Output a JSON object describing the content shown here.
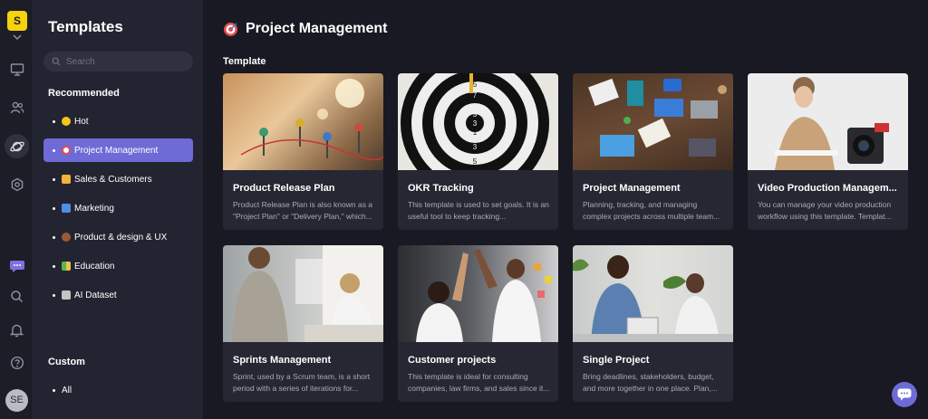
{
  "rail": {
    "logo_letter": "S",
    "user_initials": "SE"
  },
  "sidebar": {
    "title": "Templates",
    "search_placeholder": "Search",
    "recommended_label": "Recommended",
    "items": [
      {
        "label": "Hot",
        "icon": "sun-icon",
        "color": "#f5c518"
      },
      {
        "label": "Project Management",
        "icon": "target-icon",
        "color": "#e54d4d",
        "active": true
      },
      {
        "label": "Sales & Customers",
        "icon": "handshake-icon",
        "color": "#f2b33a"
      },
      {
        "label": "Marketing",
        "icon": "calendar-icon",
        "color": "#4d8fe5"
      },
      {
        "label": "Product & design & UX",
        "icon": "football-icon",
        "color": "#9b5a34"
      },
      {
        "label": "Education",
        "icon": "books-icon",
        "color": "#5fb54d"
      },
      {
        "label": "AI Dataset",
        "icon": "robot-icon",
        "color": "#c4c4c4"
      }
    ],
    "custom_label": "Custom",
    "custom_items": [
      {
        "label": "All"
      }
    ]
  },
  "main": {
    "title": "Project Management",
    "section_label": "Template",
    "cards": [
      {
        "title": "Product Release Plan",
        "desc": "Product Release Plan is also known as a \"Project Plan\" or \"Delivery Plan,\" which..."
      },
      {
        "title": "OKR Tracking",
        "desc": "This template is used to set goals. It is an useful tool to keep tracking..."
      },
      {
        "title": "Project Management",
        "desc": "Planning, tracking, and managing complex projects across multiple team..."
      },
      {
        "title": "Video Production Managem...",
        "desc": "You can manage your video production workflow using this template. Templat..."
      },
      {
        "title": "Sprints Management",
        "desc": "Sprint, used by a Scrum team, is a short period with a series of iterations for..."
      },
      {
        "title": "Customer projects",
        "desc": "This template is ideal for consulting companies, law firms, and sales since it..."
      },
      {
        "title": "Single Project",
        "desc": "Bring deadlines, stakeholders, budget, and more together in one place. Plan,..."
      }
    ],
    "target_numbers": [
      "5",
      "7",
      "9",
      "3",
      "1",
      "3",
      "5"
    ]
  },
  "colors": {
    "accent": "#6f6bd6",
    "background": "#181922",
    "sidebar": "#232431",
    "card": "#262733"
  }
}
